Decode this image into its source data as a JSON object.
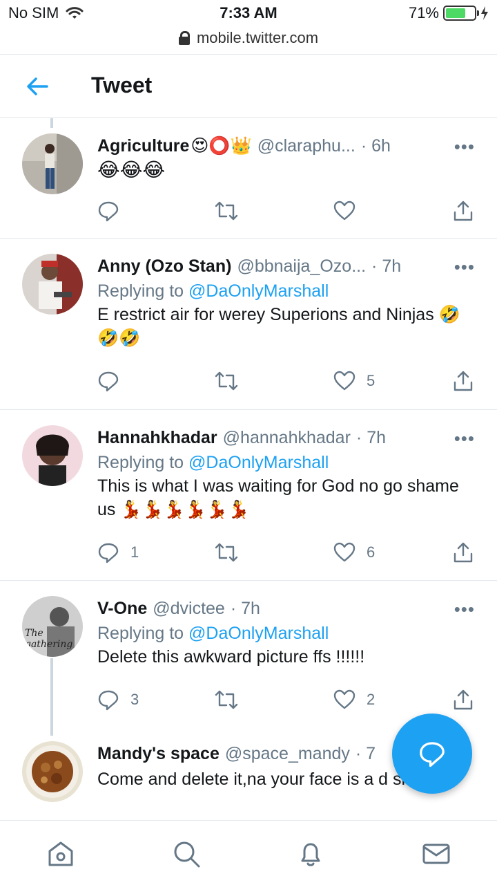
{
  "status_bar": {
    "carrier": "No SIM",
    "time": "7:33 AM",
    "battery": "71%",
    "battery_level": 0.71,
    "url": "mobile.twitter.com"
  },
  "header": {
    "title": "Tweet",
    "back_icon": "arrow-left-icon"
  },
  "colors": {
    "accent": "#1da1f2",
    "secondary_text": "#657786",
    "divider": "#e1e8ed"
  },
  "tweets": [
    {
      "name": "Agriculture",
      "name_emoji": "😍⭕👑",
      "handle": "@claraphu...",
      "time": "· 6h",
      "reply_to_prefix": "",
      "reply_to": "",
      "text": "😂😂😂",
      "reply_count": "",
      "retweet_count": "",
      "like_count": ""
    },
    {
      "name": "Anny (Ozo Stan)",
      "name_emoji": "",
      "handle": "@bbnaija_Ozo...",
      "time": "· 7h",
      "reply_to_prefix": "Replying to",
      "reply_to": "@DaOnlyMarshall",
      "text": "E restrict air for werey Superions and Ninjas 🤣🤣🤣",
      "reply_count": "",
      "retweet_count": "",
      "like_count": "5"
    },
    {
      "name": "Hannahkhadar",
      "name_emoji": "",
      "handle": "@hannahkhadar",
      "time": "· 7h",
      "reply_to_prefix": "Replying to",
      "reply_to": "@DaOnlyMarshall",
      "text": "This is what I was waiting for God no go shame us 💃💃💃💃💃💃",
      "reply_count": "1",
      "retweet_count": "",
      "like_count": "6"
    },
    {
      "name": "V-One",
      "name_emoji": "",
      "handle": "@dvictee",
      "time": "· 7h",
      "reply_to_prefix": "Replying to",
      "reply_to": "@DaOnlyMarshall",
      "text": "Delete this awkward picture ffs !!!!!!",
      "reply_count": "3",
      "retweet_count": "",
      "like_count": "2"
    },
    {
      "name": "Mandy's space",
      "name_emoji": "",
      "handle": "@space_mandy",
      "time": "· 7",
      "reply_to_prefix": "",
      "reply_to": "",
      "text": "Come and delete it,na your face is a       d sha",
      "reply_count": "",
      "retweet_count": "",
      "like_count": ""
    }
  ],
  "bottom_nav": {
    "items": [
      "home-icon",
      "search-icon",
      "notifications-icon",
      "messages-icon"
    ]
  },
  "fab": {
    "icon": "compose-reply-icon"
  }
}
